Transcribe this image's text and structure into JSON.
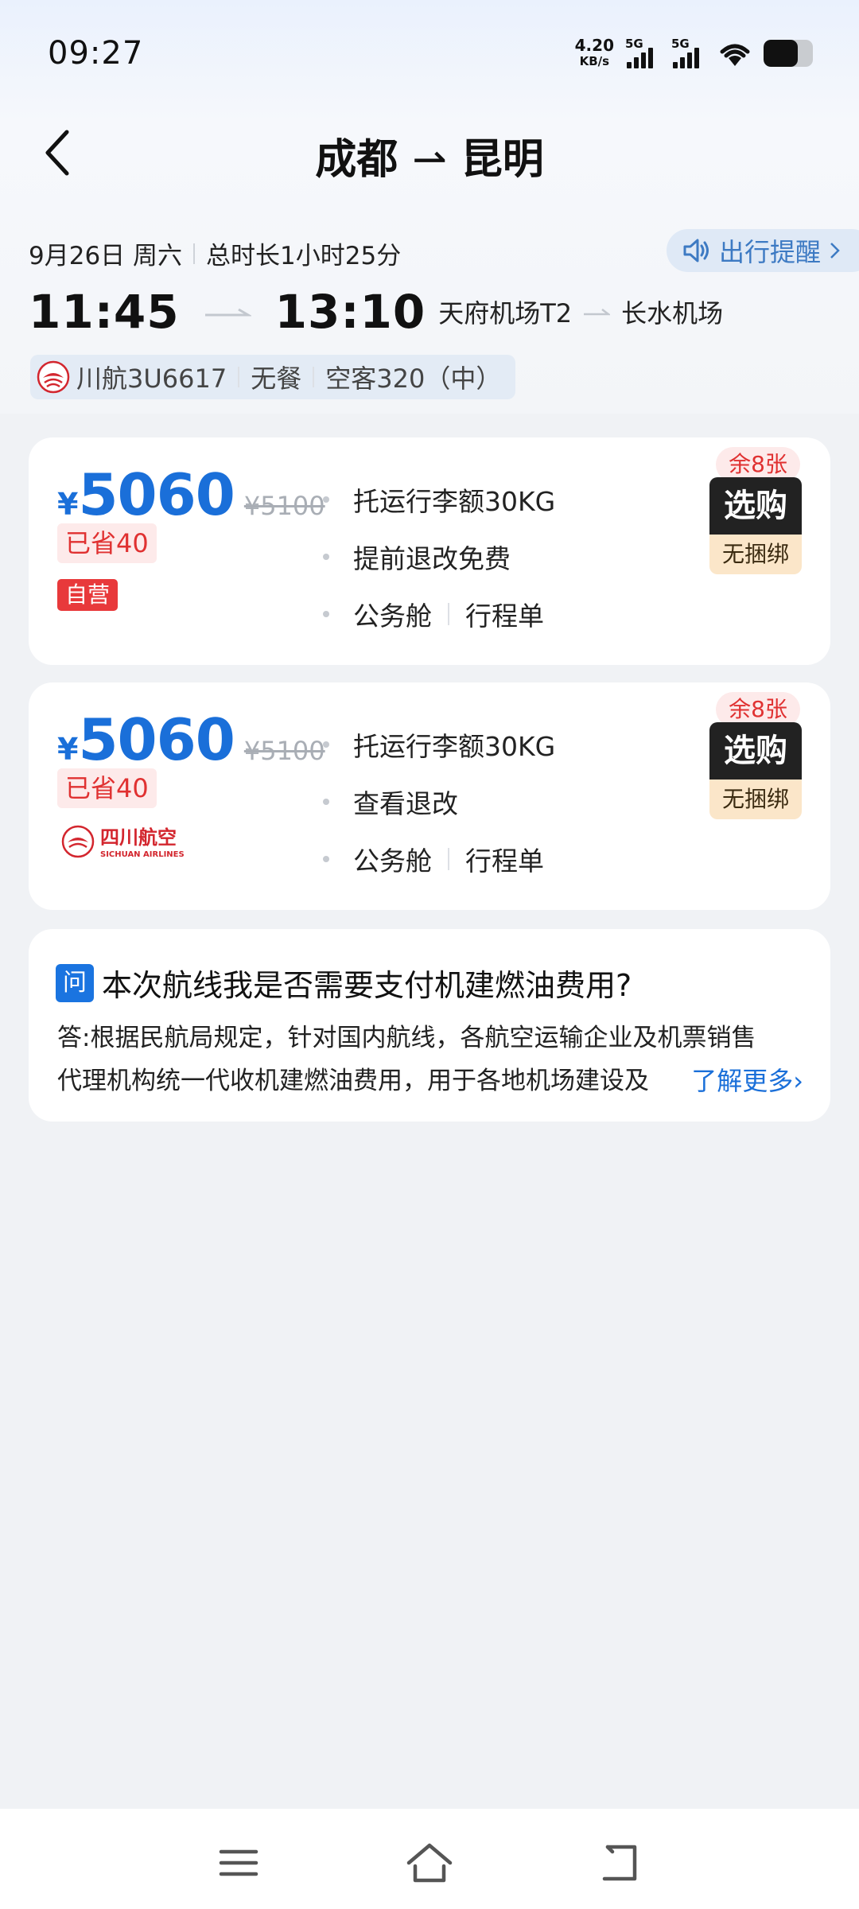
{
  "status": {
    "time": "09:27",
    "speed_value": "4.20",
    "speed_unit": "KB/s",
    "sim1": "5G",
    "sim2": "5G",
    "battery_percent": 70
  },
  "header": {
    "from": "成都",
    "to": "昆明",
    "route_arrow": "⇀"
  },
  "flight": {
    "date": "9月26日 周六",
    "duration": "总时长1小时25分",
    "reminder": "出行提醒",
    "depart_time": "11:45",
    "arrive_time": "13:10",
    "depart_airport": "天府机场T2",
    "arrive_airport": "长水机场",
    "airline": "川航3U6617",
    "meal": "无餐",
    "aircraft": "空客320（中）"
  },
  "tickets": [
    {
      "currency": "¥",
      "price": "5060",
      "original_price": "¥5100",
      "saved": "已省40",
      "tag": "自营",
      "features": [
        "托运行李额30KG",
        "提前退改免费"
      ],
      "cabin": "公务舱",
      "doc": "行程单",
      "stock": "余8张",
      "buy_label": "选购",
      "bundle": "无捆绑"
    },
    {
      "currency": "¥",
      "price": "5060",
      "original_price": "¥5100",
      "saved": "已省40",
      "brand_logo_text": "四川航空",
      "brand_logo_en": "SICHUAN AIRLINES",
      "features": [
        "托运行李额30KG",
        "查看退改"
      ],
      "cabin": "公务舱",
      "doc": "行程单",
      "stock": "余8张",
      "buy_label": "选购",
      "bundle": "无捆绑"
    }
  ],
  "faq": {
    "badge": "问",
    "question": "本次航线我是否需要支付机建燃油费用?",
    "answer_line1": "答:根据民航局规定，针对国内航线，各航空运输企业及机票销售",
    "answer_line2": "代理机构统一代收机建燃油费用，用于各地机场建设及",
    "more": "了解更多›"
  },
  "colors": {
    "accent": "#1a6fd9",
    "price": "#1a6fd9",
    "saved_red": "#e03131",
    "self_badge": "#e8393b"
  }
}
